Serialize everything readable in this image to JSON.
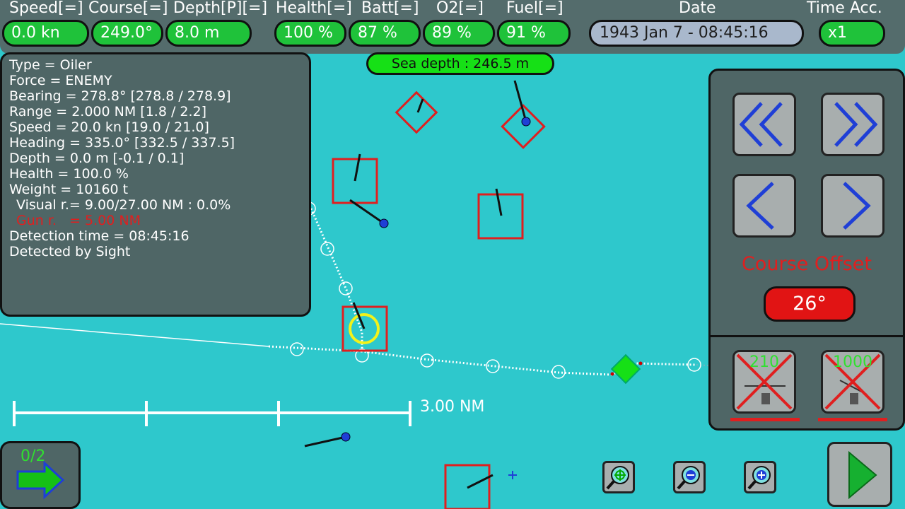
{
  "header": {
    "speed": {
      "label": "Speed[=]",
      "value": "0.0 kn"
    },
    "course": {
      "label": "Course[=]",
      "value": "249.0°"
    },
    "depth": {
      "label": "Depth[P][=]",
      "value": "8.0 m"
    },
    "health": {
      "label": "Health[=]",
      "value": "100 %"
    },
    "batt": {
      "label": "Batt[=]",
      "value": "87 %"
    },
    "o2": {
      "label": "O2[=]",
      "value": "89 %"
    },
    "fuel": {
      "label": "Fuel[=]",
      "value": "91 %"
    },
    "date": {
      "label": "Date",
      "value": "1943 Jan 7 - 08:45:16"
    },
    "time_acc": {
      "label": "Time Acc.",
      "value": "x1"
    }
  },
  "target_info": {
    "lines": [
      "Type = Oiler",
      "Force = ENEMY",
      "Bearing = 278.8° [278.8 / 278.9]",
      "Range = 2.000 NM [1.8 / 2.2]",
      "Speed = 20.0 kn [19.0 / 21.0]",
      "Heading = 335.0° [332.5 / 337.5]",
      "Depth = 0.0 m [-0.1 / 0.1]",
      "Health = 100.0 %",
      "Weight = 10160 t",
      "Visual r.= 9.00/27.00 NM : 0.0%",
      "Gun r.   = 5.00 NM",
      "Detection time = 08:45:16",
      "Detected by Sight"
    ]
  },
  "sea_depth": "Sea depth : 246.5 m",
  "course_offset": {
    "label": "Course Offset",
    "value": "26°"
  },
  "weapons": {
    "gun_value": "210",
    "torpedo_value": "1000"
  },
  "scale_label": "3.00 NM",
  "waypoints": {
    "count": "0/2"
  },
  "colors": {
    "sea": "#2ec8cc",
    "panel": "#4f6666",
    "pill_green": "#1fc23a",
    "enemy_red": "#e01f1f",
    "own_ship": "#16e016",
    "arrow_blue": "#1f3fd6"
  },
  "icons": {
    "fast_rewind": "double-chevron-left-icon",
    "fast_forward": "double-chevron-right-icon",
    "rewind": "chevron-left-icon",
    "forward": "chevron-right-icon",
    "gun": "deck-gun-icon",
    "torpedo": "torpedo-icon",
    "waypoint": "arrow-right-icon",
    "zoom_center": "zoom-center-icon",
    "zoom_out": "zoom-out-icon",
    "zoom_in": "zoom-in-icon",
    "play": "play-icon"
  }
}
